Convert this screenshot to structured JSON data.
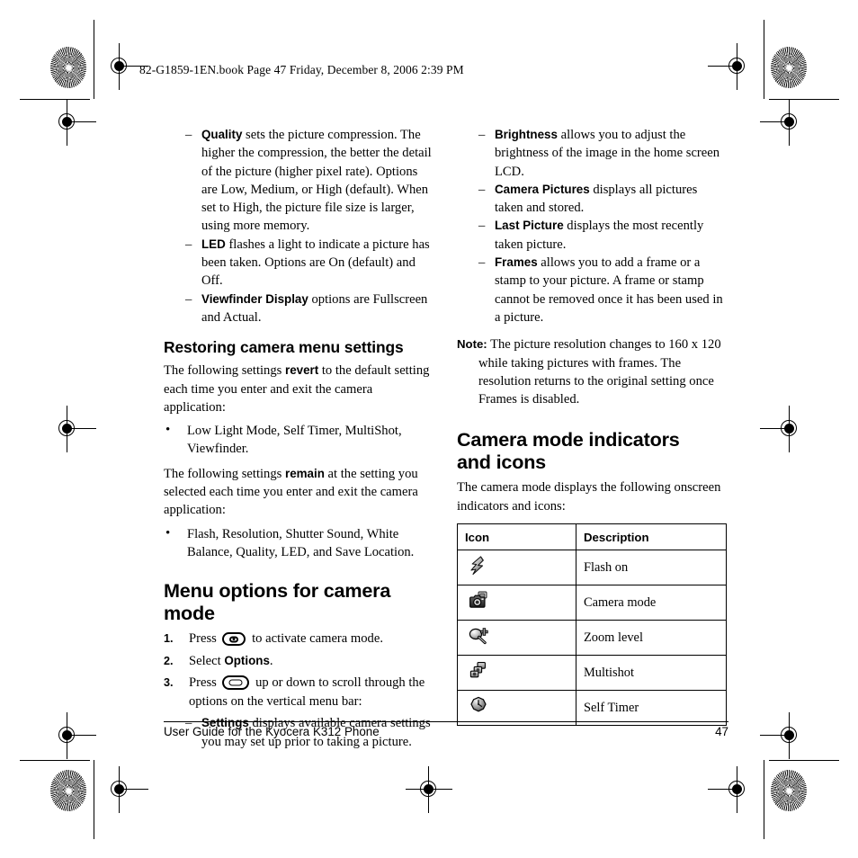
{
  "page": {
    "header_stamp": "82-G1859-1EN.book  Page 47  Friday, December 8, 2006  2:39 PM",
    "footer_text": "User Guide for the Kyocera K312 Phone",
    "page_number": "47"
  },
  "left_column": {
    "settings_list": [
      {
        "term": "Quality",
        "rest": " sets the picture compression. The higher the compression, the better the detail of the picture (higher pixel rate). Options are Low, Medium, or High (default). When set to High, the picture file size is larger, using more memory."
      },
      {
        "term": "LED",
        "rest": " flashes a light to indicate a picture has been taken. Options are On (default) and Off."
      },
      {
        "term": "Viewfinder Display",
        "rest": " options are Fullscreen and Actual."
      }
    ],
    "restoring_heading": "Restoring camera menu settings",
    "revert_intro_a": "The following settings ",
    "revert_bold": "revert",
    "revert_intro_b": " to the default setting each time you enter and exit the camera application:",
    "revert_items": [
      "Low Light Mode, Self Timer, MultiShot, Viewfinder."
    ],
    "remain_intro_a": "The following settings ",
    "remain_bold": "remain",
    "remain_intro_b": " at the setting you selected each time you enter and exit the camera application:",
    "remain_items": [
      "Flash, Resolution, Shutter Sound, White Balance, Quality, LED, and Save Location."
    ],
    "menu_heading": "Menu options for camera mode",
    "steps": [
      {
        "pre": "Press ",
        "key": "camera-key",
        "post": " to activate camera mode."
      },
      {
        "pre": "Select ",
        "bold": "Options",
        "post": "."
      },
      {
        "pre": "Press ",
        "key": "navigation-key",
        "post": " up or down to scroll through the options on the vertical menu bar:"
      }
    ],
    "step3_sub": [
      {
        "term": "Settings",
        "rest": " displays available camera settings you may set up prior to taking a picture."
      }
    ]
  },
  "right_column": {
    "settings_list": [
      {
        "term": "Brightness",
        "rest": " allows you to adjust the brightness of the image in the home screen LCD."
      },
      {
        "term": "Camera Pictures",
        "rest": " displays all pictures taken and stored."
      },
      {
        "term": "Last Picture",
        "rest": " displays the most recently taken picture."
      },
      {
        "term": "Frames",
        "rest": " allows you to add a frame or a stamp to your picture. A frame or stamp cannot be removed once it has been used in a picture."
      }
    ],
    "note_label": "Note:",
    "note_text": "  The picture resolution changes to 160 x 120 while taking pictures with frames. The resolution returns to the original setting once Frames is disabled.",
    "indicators_heading_line1": "Camera mode indicators",
    "indicators_heading_line2": "and icons",
    "indicators_intro": "The camera mode displays the following onscreen indicators and icons:",
    "table": {
      "headers": [
        "Icon",
        "Description"
      ],
      "rows": [
        {
          "icon": "flash-on-icon",
          "description": "Flash on"
        },
        {
          "icon": "camera-mode-icon",
          "description": "Camera mode"
        },
        {
          "icon": "zoom-level-icon",
          "description": "Zoom level"
        },
        {
          "icon": "multishot-icon",
          "description": "Multishot"
        },
        {
          "icon": "self-timer-icon",
          "description": "Self Timer"
        }
      ]
    }
  },
  "colors": {
    "ink": "#000000",
    "paper": "#ffffff",
    "icon_dark": "#2b2b2b",
    "icon_mid": "#8c8c8c",
    "icon_light": "#d4d4d4"
  }
}
